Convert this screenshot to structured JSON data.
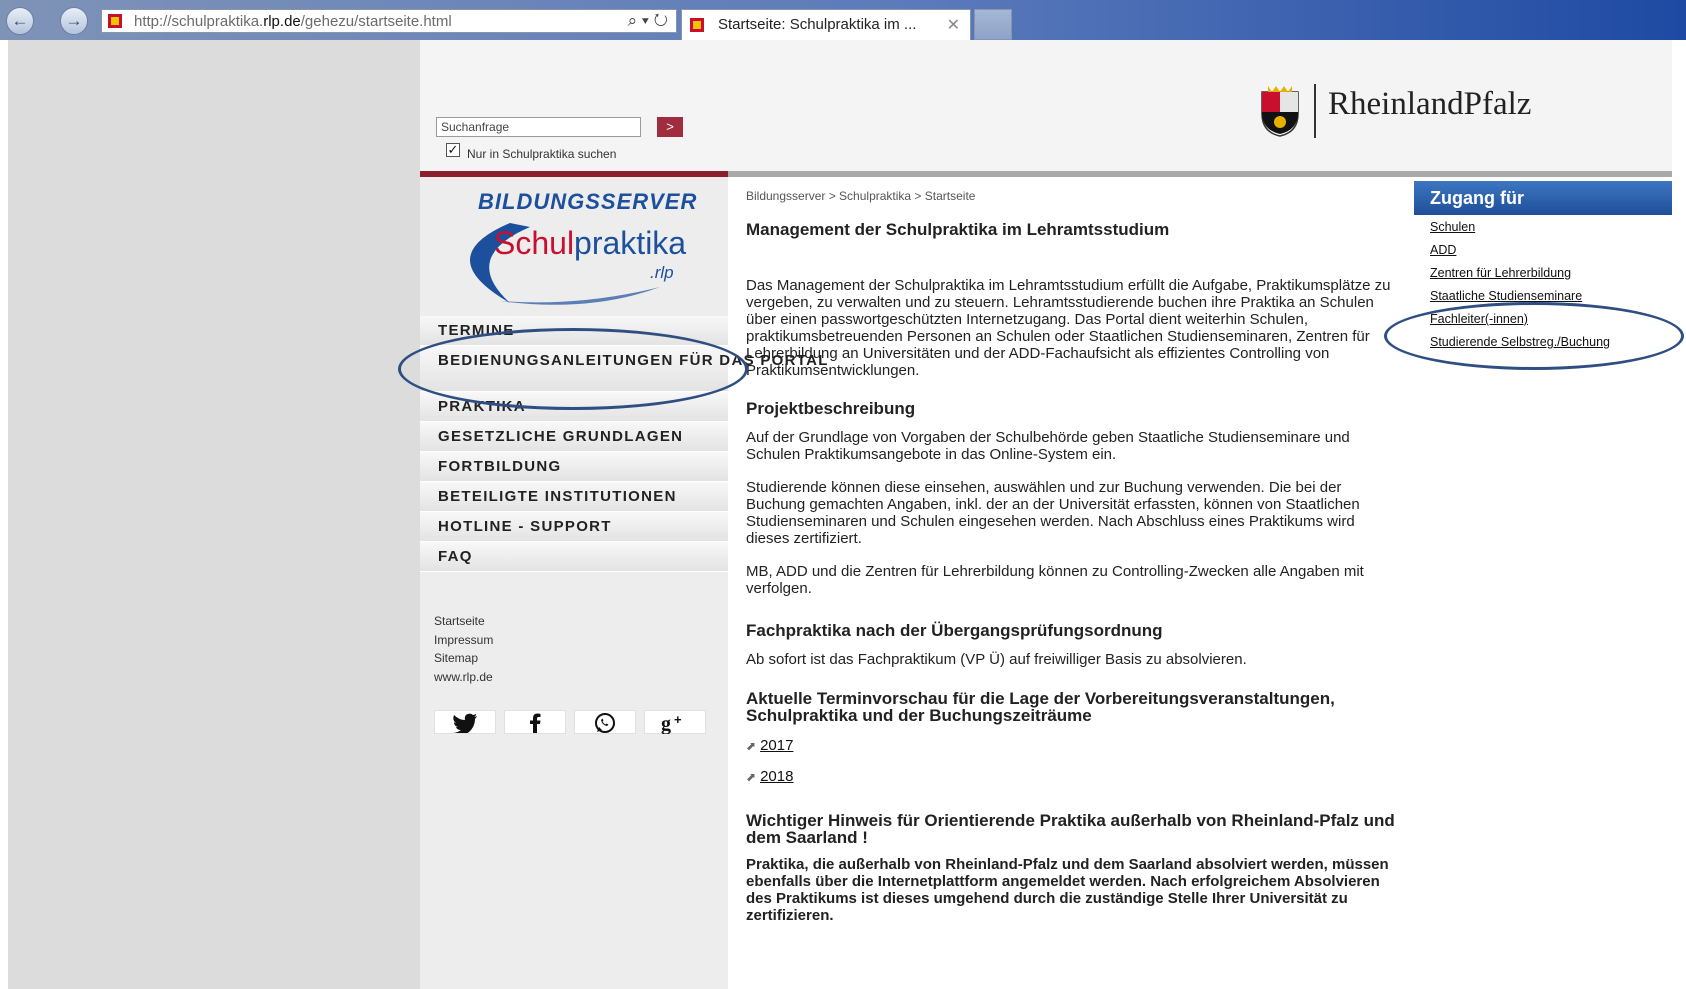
{
  "browser": {
    "url_prefix": "http://schulpraktika.",
    "url_domain": "rlp.de",
    "url_path": "/gehezu/startseite.html",
    "address_tools": "⌕ ▾ ↻",
    "tab_title": "Startseite: Schulpraktika im ...",
    "tab_close": "✕",
    "back": "←",
    "forward": "→"
  },
  "header": {
    "search_placeholder": "Suchanfrage",
    "search_button": ">",
    "checkbox_mark": "✓",
    "checkbox_label": "Nur in Schulpraktika suchen",
    "state_logo": "RheinlandPfalz"
  },
  "sidebar": {
    "bildungs": "BILDUNGS",
    "server": "SERVER",
    "schul": "Schul",
    "praktika": "praktika",
    "rlp": ".rlp",
    "menu": [
      "TERMINE",
      "BEDIENUNGSANLEITUNGEN FÜR DAS PORTAL",
      "PRAKTIKA",
      "GESETZLICHE GRUNDLAGEN",
      "FORTBILDUNG",
      "BETEILIGTE INSTITUTIONEN",
      "HOTLINE - SUPPORT",
      "FAQ"
    ],
    "footer_links": [
      "Startseite",
      "Impressum",
      "Sitemap",
      "www.rlp.de"
    ],
    "social": [
      "twitter",
      "facebook",
      "whatsapp",
      "google-plus"
    ]
  },
  "main": {
    "breadcrumb": "Bildungsserver > Schulpraktika > Startseite",
    "h1": "Management der Schulpraktika im Lehramtsstudium",
    "intro": "Das Management der Schulpraktika im Lehramtsstudium erfüllt die Aufgabe, Praktikumsplätze zu vergeben, zu verwalten und zu steuern. Lehramtsstudierende buchen ihre Praktika an Schulen über einen passwortgeschützten Internetzugang. Das Portal dient weiterhin Schulen, praktikumsbetreuenden Personen an Schulen oder Staatlichen Studienseminaren, Zentren für Lehrerbildung an Universitäten und der ADD-Fachaufsicht als effizientes Controlling von Praktikumsentwicklungen.",
    "h2_projekt": "Projektbeschreibung",
    "p_projekt1": "Auf der Grundlage von Vorgaben der Schulbehörde geben Staatliche Studienseminare und Schulen Praktikumsangebote in das Online-System ein.",
    "p_projekt2": "Studierende können diese einsehen, auswählen und zur Buchung verwenden. Die bei der Buchung gemachten Angaben, inkl. der an der Universität erfassten, können von Staatlichen Studienseminaren und Schulen eingesehen werden. Nach Abschluss eines Praktikums wird dieses zertifiziert.",
    "p_projekt3": "MB, ADD und die Zentren für Lehrerbildung können zu Controlling-Zwecken alle Angaben mit verfolgen.",
    "h2_fach": "Fachpraktika nach der Übergangsprüfungsordnung",
    "p_fach": "Ab sofort ist das Fachpraktikum (VP Ü) auf freiwilliger Basis zu absolvieren.",
    "h2_termin": "Aktuelle Terminvorschau für die Lage der Vorbereitungsveranstaltungen, Schulpraktika und der Buchungszeiträume",
    "link_2017": "2017",
    "link_2018": "2018",
    "link_arrow": "⬈",
    "h2_hinweis": "Wichtiger Hinweis für Orientierende Praktika außerhalb von Rheinland-Pfalz und dem Saarland !",
    "p_hinweis": "Praktika, die außerhalb von Rheinland-Pfalz und dem Saarland absolviert werden, müssen ebenfalls über die Internetplattform angemeldet werden. Nach erfolgreichem Absolvieren des Praktikums ist dieses umgehend durch die zuständige Stelle Ihrer Universität zu  zertifizieren."
  },
  "rightbox": {
    "title": "Zugang für",
    "links": [
      "Schulen",
      "ADD",
      "Zentren für Lehrerbildung",
      "Staatliche Studienseminare",
      "Fachleiter(-innen)",
      "Studierende Selbstreg./Buchung"
    ]
  }
}
